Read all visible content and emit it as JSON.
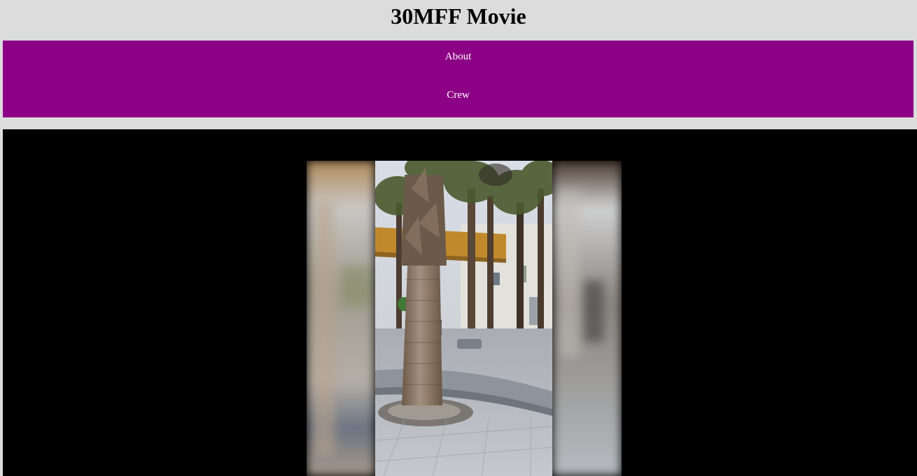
{
  "header": {
    "title": "30MFF Movie"
  },
  "nav": {
    "items": [
      {
        "label": "About"
      },
      {
        "label": "Crew"
      }
    ],
    "background_color": "#8b0084",
    "text_color": "#ffffff"
  },
  "video": {
    "frame_description_icon": "video-frame-palm-trees"
  }
}
